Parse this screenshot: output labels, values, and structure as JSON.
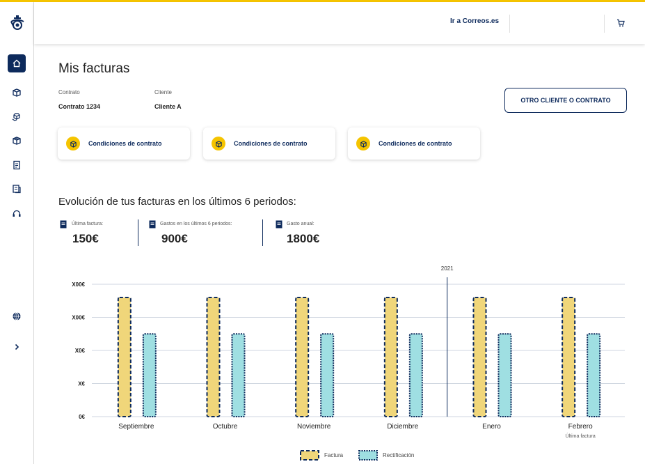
{
  "topbar": {
    "link_label": "Ir a Correos.es",
    "cart_icon": "cart-icon"
  },
  "sidebar": {
    "logo_icon": "posthorn-logo-icon",
    "items": [
      {
        "icon": "home-icon",
        "active": true
      },
      {
        "icon": "package-icon",
        "active": false
      },
      {
        "icon": "packages-icon",
        "active": false
      },
      {
        "icon": "parcel-icon",
        "active": false
      },
      {
        "icon": "invoice-icon",
        "active": false
      },
      {
        "icon": "documents-icon",
        "active": false
      },
      {
        "icon": "support-icon",
        "active": false
      },
      {
        "icon": "globe-icon",
        "active": false
      },
      {
        "icon": "chevron-right-icon",
        "active": false
      }
    ]
  },
  "main": {
    "title": "Mis facturas",
    "contract_label": "Contrato",
    "contract_value": "Contrato 1234",
    "client_label": "Cliente",
    "client_value": "Cliente A",
    "other_button": "OTRO CLIENTE O CONTRATO",
    "cards": [
      {
        "label": "Condiciones de contrato"
      },
      {
        "label": "Condiciones de contrato"
      },
      {
        "label": "Condiciones de contrato"
      }
    ],
    "evolution_title": "Evolución de tus facturas en los últimos 6 periodos:",
    "stats": [
      {
        "label": "Última factura:",
        "value": "150€"
      },
      {
        "label": "Gastos en los últimos 6 periodos:",
        "value": "900€"
      },
      {
        "label": "Gasto anual:",
        "value": "1800€"
      }
    ]
  },
  "chart_data": {
    "type": "bar",
    "categories": [
      "Septiembre",
      "Octubre",
      "Noviembre",
      "Diciembre",
      "Enero",
      "Febrero"
    ],
    "category_sublabels": [
      "",
      "",
      "",
      "",
      "",
      "Última factura"
    ],
    "y_tick_labels": [
      "0€",
      "X€",
      "X0€",
      "X00€",
      "X00€"
    ],
    "year_marker": {
      "label": "2021",
      "before_category": "Enero"
    },
    "series": [
      {
        "name": "Factura",
        "color": "#f0d67a",
        "border": "#0d2a5c",
        "values": [
          3.6,
          3.6,
          3.6,
          3.6,
          3.6,
          3.6
        ]
      },
      {
        "name": "Rectificación",
        "color": "#9fdfe2",
        "border": "#0d2a5c",
        "values": [
          2.5,
          2.5,
          2.5,
          2.5,
          2.5,
          2.5
        ]
      }
    ],
    "ylim": [
      0,
      4
    ],
    "grid": true,
    "legend": "bottom-center"
  }
}
